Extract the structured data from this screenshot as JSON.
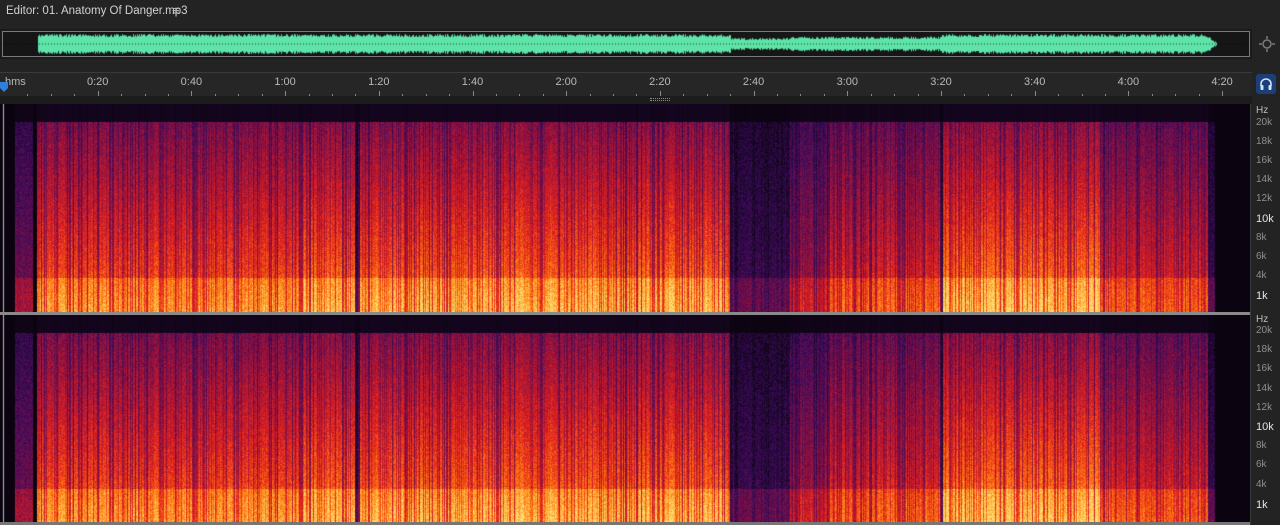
{
  "editor": {
    "title": "Editor: 01. Anatomy Of Danger.mp3",
    "menu_icon": "hamburger-menu-icon"
  },
  "overview": {
    "waveform_color": "#5ee3a8",
    "zoom_icon": "zoom-navigator-icon"
  },
  "ruler": {
    "unit_label": "hms",
    "ticks": [
      "0:20",
      "0:40",
      "1:00",
      "1:20",
      "1:40",
      "2:00",
      "2:20",
      "2:40",
      "3:00",
      "3:20",
      "3:40",
      "4:00",
      "4:20"
    ],
    "playhead_icon": "playhead-marker-icon",
    "lock_icon": "headphones-lock-icon",
    "accent_color": "#2f7fe0"
  },
  "frequency_scale": {
    "unit": "Hz",
    "labels": [
      "20k",
      "18k",
      "16k",
      "14k",
      "12k",
      "10k",
      "8k",
      "6k",
      "4k",
      "1k"
    ],
    "bright_labels": [
      "10k",
      "1k"
    ]
  },
  "spectral_display": {
    "channels": 2,
    "palette": [
      "#0b0410",
      "#3a0b5a",
      "#8b1040",
      "#e02020",
      "#ff7a10",
      "#ffe070"
    ]
  }
}
